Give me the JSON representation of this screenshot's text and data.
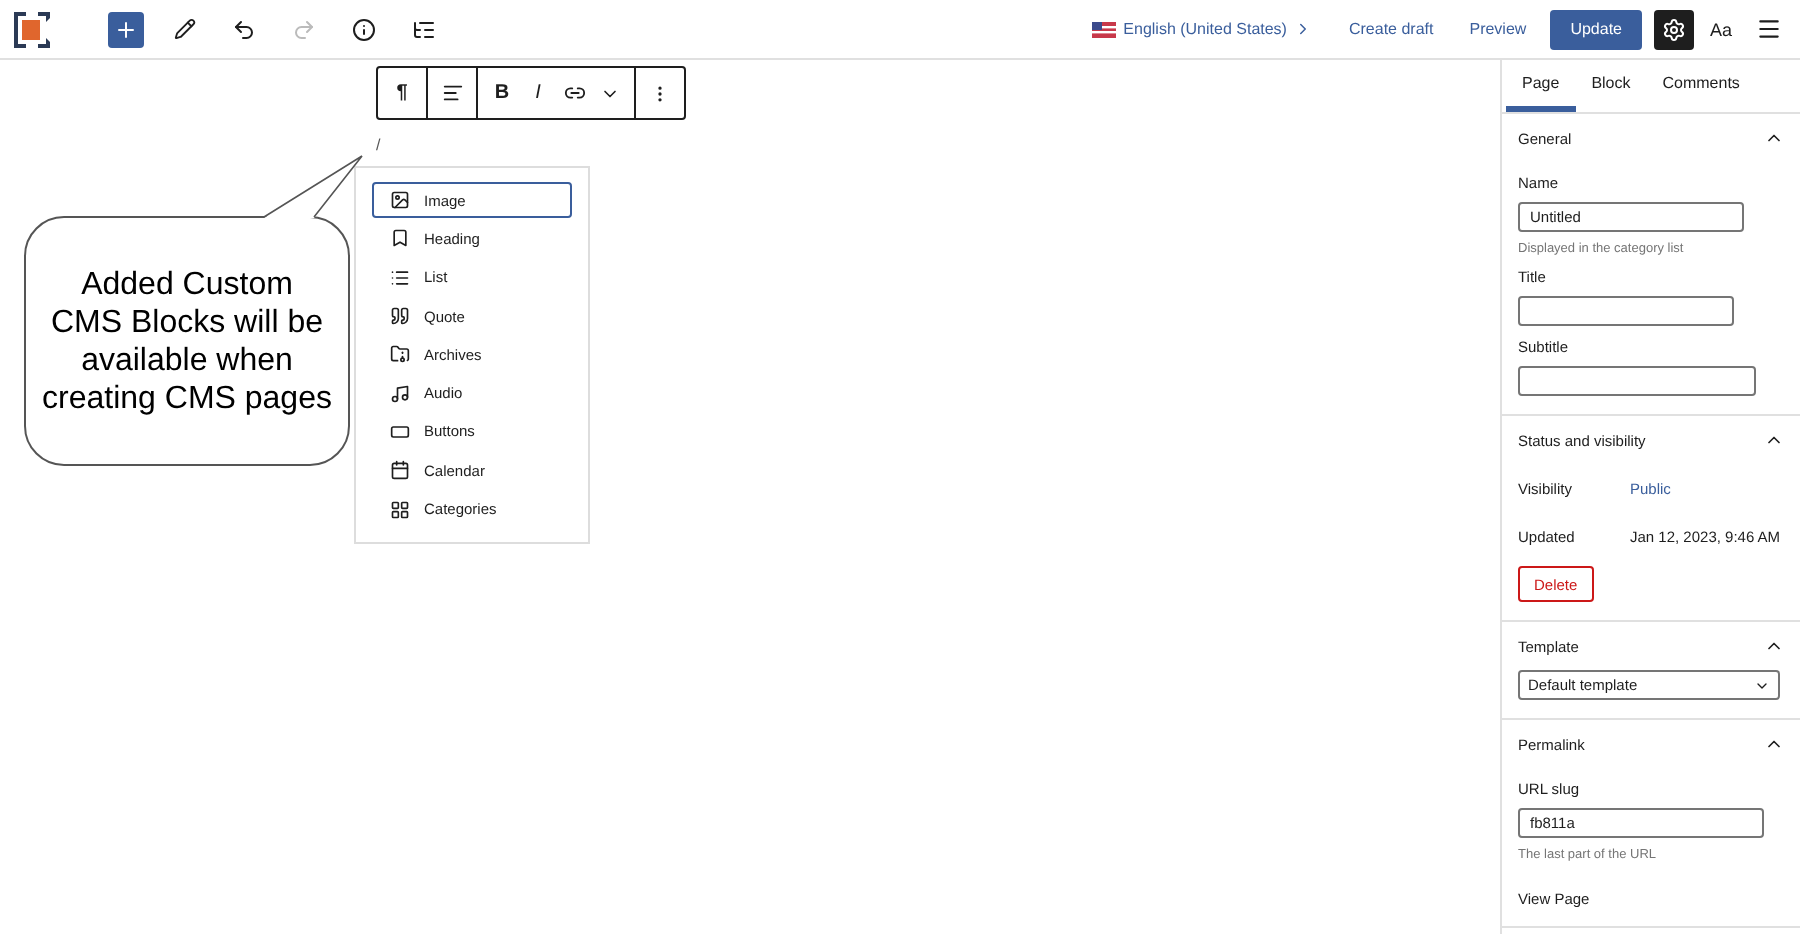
{
  "header": {
    "language": "English (United States)",
    "create_draft": "Create draft",
    "preview": "Preview",
    "update": "Update",
    "settings_active": true,
    "typography": "Aa"
  },
  "block_toolbar": {
    "paragraph": "¶",
    "bold": "B",
    "italic": "I"
  },
  "editor": {
    "slash": "/"
  },
  "inserter": {
    "items": [
      {
        "label": "Image",
        "selected": true
      },
      {
        "label": "Heading",
        "selected": false
      },
      {
        "label": "List",
        "selected": false
      },
      {
        "label": "Quote",
        "selected": false
      },
      {
        "label": "Archives",
        "selected": false
      },
      {
        "label": "Audio",
        "selected": false
      },
      {
        "label": "Buttons",
        "selected": false
      },
      {
        "label": "Calendar",
        "selected": false
      },
      {
        "label": "Categories",
        "selected": false
      }
    ]
  },
  "callout": {
    "text": "Added Custom CMS Blocks will be available when creating CMS pages"
  },
  "sidebar": {
    "tabs": [
      {
        "label": "Page",
        "selected": true
      },
      {
        "label": "Block",
        "selected": false
      },
      {
        "label": "Comments",
        "selected": false
      }
    ],
    "panels": [
      {
        "kind": "form",
        "title": "General",
        "expanded": true,
        "fields": [
          {
            "label": "Name",
            "value": "Untitled",
            "help": "Displayed in the category list"
          },
          {
            "label": "Title"
          },
          {
            "label": "Subtitle"
          }
        ]
      },
      {
        "kind": "status",
        "title": "Status and visibility",
        "expanded": true,
        "rows": [
          {
            "label": "Visibility",
            "value": "Public",
            "kind": "link"
          },
          {
            "label": "Updated",
            "value": "Jan 12, 2023, 9:46 AM",
            "kind": "text"
          }
        ],
        "delete": "Delete"
      },
      {
        "kind": "select",
        "title": "Template",
        "expanded": true,
        "value": "Default template"
      },
      {
        "kind": "permalink",
        "title": "Permalink",
        "expanded": true,
        "label": "URL slug",
        "value": "fb811a",
        "help": "The last part of the URL",
        "link": "View Page"
      }
    ]
  }
}
